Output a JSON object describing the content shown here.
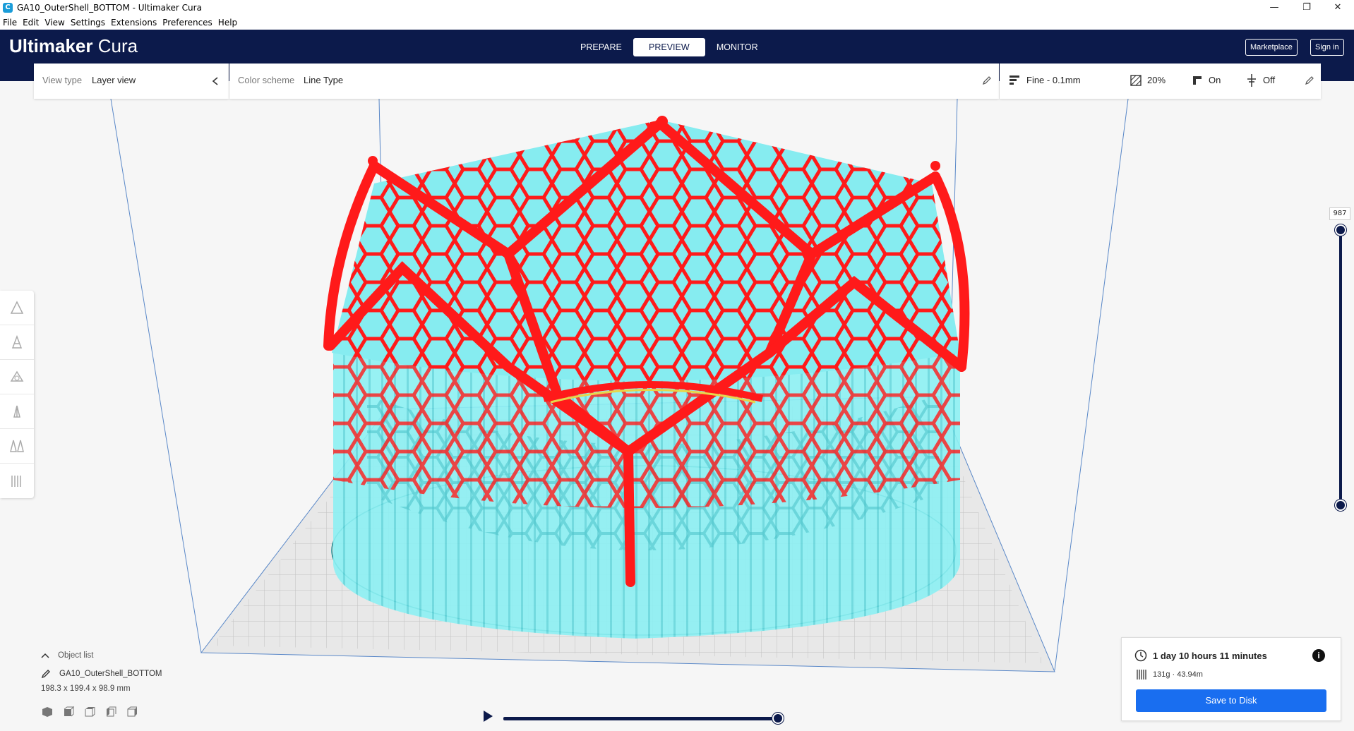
{
  "window": {
    "title": "GA10_OuterShell_BOTTOM - Ultimaker Cura",
    "minimize_glyph": "—",
    "maximize_glyph": "❐",
    "close_glyph": "✕"
  },
  "menu": [
    "File",
    "Edit",
    "View",
    "Settings",
    "Extensions",
    "Preferences",
    "Help"
  ],
  "header": {
    "logo_bold": "Ultimaker",
    "logo_light": "Cura",
    "tabs": [
      "PREPARE",
      "PREVIEW",
      "MONITOR"
    ],
    "active_tab": "PREVIEW",
    "marketplace": "Marketplace",
    "signin": "Sign in"
  },
  "view_panel": {
    "view_type_label": "View type",
    "view_type_value": "Layer view",
    "color_scheme_label": "Color scheme",
    "color_scheme_value": "Line Type"
  },
  "print_settings": {
    "profile": "Fine - 0.1mm",
    "infill": "20%",
    "support": "On",
    "adhesion": "Off"
  },
  "layer_slider": {
    "current_layer": "987"
  },
  "object_list": {
    "label": "Object list",
    "name": "GA10_OuterShell_BOTTOM",
    "dimensions": "198.3 x 199.4 x 98.9 mm"
  },
  "print_info": {
    "time": "1 day 10 hours 11 minutes",
    "material": "131g · 43.94m",
    "save_button": "Save to Disk",
    "info_glyph": "i"
  },
  "colors": {
    "header": "#0c1a4b",
    "accent": "#196ef0",
    "shell": "#ff1a1a",
    "support": "#7ce8ee",
    "plate": "#d8d8d8"
  }
}
